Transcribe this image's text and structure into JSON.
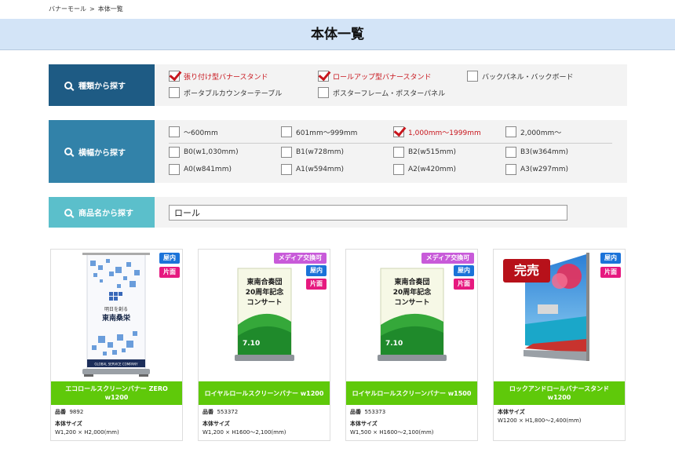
{
  "breadcrumb": {
    "home": "バナーモール",
    "sep": ">",
    "current": "本体一覧"
  },
  "page_title": "本体一覧",
  "filters": {
    "type": {
      "label": "種類から探す",
      "color": "#1e5b84",
      "options": [
        {
          "label": "張り付け型バナースタンド",
          "checked": true
        },
        {
          "label": "ロールアップ型バナースタンド",
          "checked": true
        },
        {
          "label": "バックパネル・バックボード",
          "checked": false
        },
        {
          "label": "ポータブルカウンターテーブル",
          "checked": false
        },
        {
          "label": "ポスターフレーム・ポスターパネル",
          "checked": false
        }
      ]
    },
    "width": {
      "label": "横幅から探す",
      "color": "#3282a9",
      "options": [
        {
          "label": "～600mm",
          "checked": false
        },
        {
          "label": "601mm～999mm",
          "checked": false
        },
        {
          "label": "1,000mm～1999mm",
          "checked": true
        },
        {
          "label": "2,000mm～",
          "checked": false
        },
        {
          "label": "B0(w1,030mm)",
          "checked": false
        },
        {
          "label": "B1(w728mm)",
          "checked": false
        },
        {
          "label": "B2(w515mm)",
          "checked": false
        },
        {
          "label": "B3(w364mm)",
          "checked": false
        },
        {
          "label": "A0(w841mm)",
          "checked": false
        },
        {
          "label": "A1(w594mm)",
          "checked": false
        },
        {
          "label": "A2(w420mm)",
          "checked": false
        },
        {
          "label": "A3(w297mm)",
          "checked": false
        }
      ]
    },
    "name": {
      "label": "商品名から探す",
      "color": "#5bbfcb",
      "value": "ロール"
    }
  },
  "badges": {
    "indoor": "屋内",
    "single": "片面",
    "media": "メディア交換可",
    "soldout": "完売"
  },
  "colors": {
    "name_bar": "#5fc90a",
    "indoor": "#1b73d9",
    "single": "#e6197f",
    "media": "#c85ad9",
    "soldout": "#b7111a"
  },
  "poster": {
    "brand_small": "明日を創る",
    "brand_name": "東南桑栄",
    "brand_footer": "GLOBAL SERVICE COMPANY",
    "concert_line1": "東南合奏団",
    "concert_line2": "20周年記念",
    "concert_line3": "コンサート",
    "concert_date": "7.10"
  },
  "products": [
    {
      "name": "エコロールスクリーンバナー ZERO w1200",
      "code_label": "品番",
      "code": "9892",
      "size_label": "本体サイズ",
      "size": "W1,200 × H2,000(mm)"
    },
    {
      "name": "ロイヤルロールスクリーンバナー w1200",
      "code_label": "品番",
      "code": "553372",
      "size_label": "本体サイズ",
      "size": "W1,200 × H1600～2,100(mm)"
    },
    {
      "name": "ロイヤルロールスクリーンバナー w1500",
      "code_label": "品番",
      "code": "553373",
      "size_label": "本体サイズ",
      "size": "W1,500 × H1600～2,100(mm)"
    },
    {
      "name": "ロックアンドロールバナースタンド w1200",
      "size_label": "本体サイズ",
      "size": "W1200 × H1,800～2,400(mm)"
    }
  ]
}
